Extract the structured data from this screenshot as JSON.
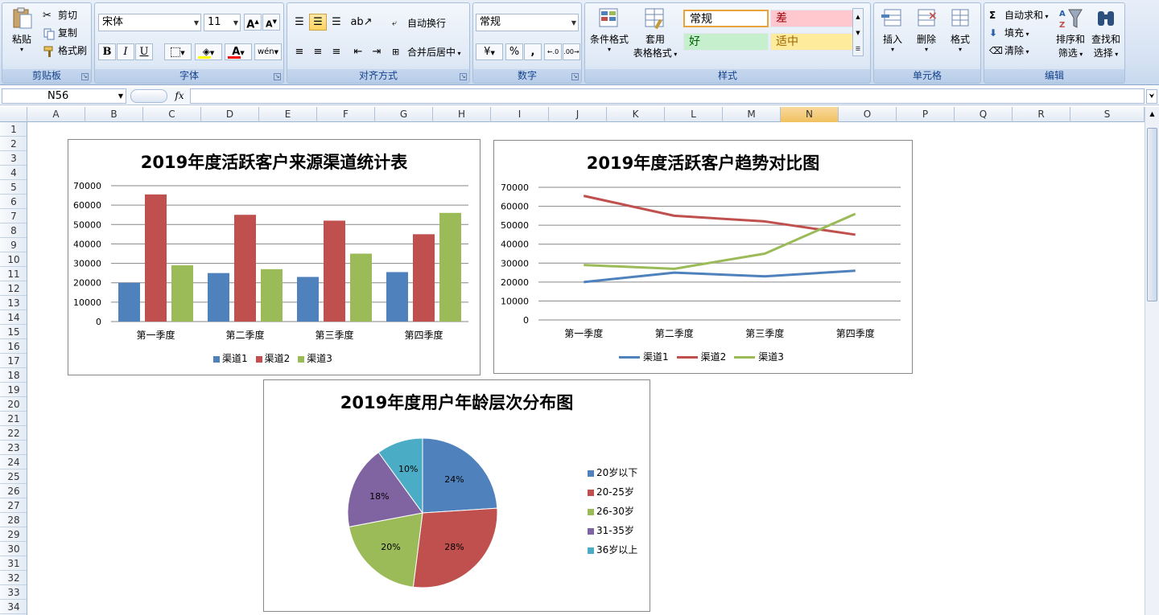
{
  "ribbon": {
    "clipboard": {
      "paste": "粘贴",
      "cut": "剪切",
      "copy": "复制",
      "format_painter": "格式刷",
      "label": "剪贴板"
    },
    "font": {
      "name": "宋体",
      "size": "11",
      "label": "字体",
      "bold": "B",
      "italic": "I",
      "underline": "U"
    },
    "alignment": {
      "wrap": "自动换行",
      "merge": "合并后居中",
      "label": "对齐方式"
    },
    "number": {
      "format": "常规",
      "percent": "%",
      "comma": ",",
      "label": "数字"
    },
    "styles": {
      "conditional": "条件格式",
      "table_format_1": "套用",
      "table_format_2": "表格格式",
      "label": "样式",
      "cells": [
        {
          "text": "常规",
          "bg": "#ffffff",
          "color": "#000000"
        },
        {
          "text": "差",
          "bg": "#ffc7ce",
          "color": "#9c0006"
        },
        {
          "text": "好",
          "bg": "#c6efce",
          "color": "#006100"
        },
        {
          "text": "适中",
          "bg": "#ffeb9c",
          "color": "#9c6500"
        }
      ]
    },
    "cells_group": {
      "insert": "插入",
      "delete": "删除",
      "format": "格式",
      "label": "单元格"
    },
    "editing": {
      "autosum": "自动求和",
      "fill": "填充",
      "clear": "清除",
      "sort_1": "排序和",
      "sort_2": "筛选",
      "find_1": "查找和",
      "find_2": "选择",
      "label": "编辑"
    }
  },
  "formula_bar": {
    "name_box": "N56",
    "fx": "fx",
    "formula": ""
  },
  "columns": [
    "A",
    "B",
    "C",
    "D",
    "E",
    "F",
    "G",
    "H",
    "I",
    "J",
    "K",
    "L",
    "M",
    "N",
    "O",
    "P",
    "Q",
    "R",
    "S"
  ],
  "active_column": "N",
  "rows": [
    "1",
    "2",
    "3",
    "4",
    "5",
    "6",
    "7",
    "8",
    "9",
    "10",
    "11",
    "12",
    "13",
    "14",
    "15",
    "16",
    "17",
    "18",
    "19",
    "20",
    "21",
    "22",
    "23",
    "24",
    "25",
    "26",
    "27",
    "28",
    "29",
    "30",
    "31",
    "32",
    "33",
    "34"
  ],
  "chart_data": [
    {
      "type": "bar",
      "title": "2019年度活跃客户来源渠道统计表",
      "categories": [
        "第一季度",
        "第二季度",
        "第三季度",
        "第四季度"
      ],
      "series": [
        {
          "name": "渠道1",
          "color": "#4f81bd",
          "values": [
            20000,
            25000,
            23000,
            25500
          ]
        },
        {
          "name": "渠道2",
          "color": "#c0504d",
          "values": [
            65500,
            55000,
            52000,
            45000
          ]
        },
        {
          "name": "渠道3",
          "color": "#9bbb59",
          "values": [
            29000,
            27000,
            35000,
            56000
          ]
        }
      ],
      "yticks": [
        "0",
        "10000",
        "20000",
        "30000",
        "40000",
        "50000",
        "60000",
        "70000"
      ],
      "ylim": [
        0,
        70000
      ],
      "grid": true,
      "legend": "bottom"
    },
    {
      "type": "line",
      "title": "2019年度活跃客户趋势对比图",
      "categories": [
        "第一季度",
        "第二季度",
        "第三季度",
        "第四季度"
      ],
      "series": [
        {
          "name": "渠道1",
          "color": "#4f81bd",
          "values": [
            20000,
            25000,
            23000,
            26000
          ]
        },
        {
          "name": "渠道2",
          "color": "#c0504d",
          "values": [
            65500,
            55000,
            52000,
            45000
          ]
        },
        {
          "name": "渠道3",
          "color": "#9bbb59",
          "values": [
            29000,
            27000,
            35000,
            56000
          ]
        }
      ],
      "yticks": [
        "0",
        "10000",
        "20000",
        "30000",
        "40000",
        "50000",
        "60000",
        "70000"
      ],
      "ylim": [
        0,
        70000
      ],
      "grid": true,
      "legend": "bottom"
    },
    {
      "type": "pie",
      "title": "2019年度用户年龄层次分布图",
      "slices": [
        {
          "name": "20岁以下",
          "value": 24,
          "label": "24%",
          "color": "#4f81bd"
        },
        {
          "name": "20-25岁",
          "value": 28,
          "label": "28%",
          "color": "#c0504d"
        },
        {
          "name": "26-30岁",
          "value": 20,
          "label": "20%",
          "color": "#9bbb59"
        },
        {
          "name": "31-35岁",
          "value": 18,
          "label": "18%",
          "color": "#8064a2"
        },
        {
          "name": "36岁以上",
          "value": 10,
          "label": "10%",
          "color": "#4bacc6"
        }
      ],
      "legend": "right"
    }
  ]
}
